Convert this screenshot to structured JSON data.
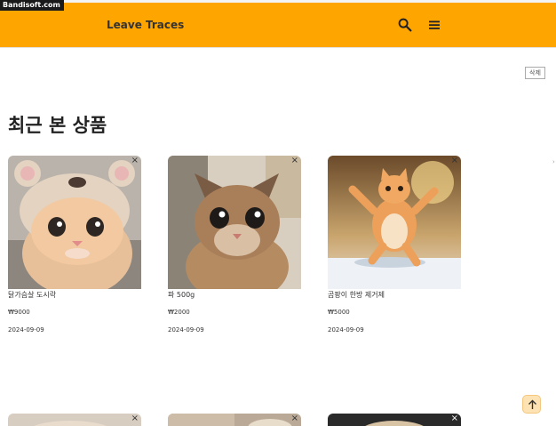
{
  "watermark": "Bandisoft.com",
  "header": {
    "brand": "Leave Traces",
    "search_icon": "search-icon",
    "menu_icon": "hamburger-menu-icon",
    "background": "#ffa500"
  },
  "toolbar": {
    "delete_label": "삭제"
  },
  "page": {
    "title": "최근 본 상품"
  },
  "products": [
    {
      "name": "닭가슴살 도시락",
      "price": "₩9000",
      "date": "2024-09-09",
      "close": "×"
    },
    {
      "name": "파 500g",
      "price": "₩2000",
      "date": "2024-09-09",
      "close": "×"
    },
    {
      "name": "곰팡이 한방 제거제",
      "price": "₩5000",
      "date": "2024-09-09",
      "close": "×"
    }
  ],
  "products_row2": [
    {
      "close": "×"
    },
    {
      "close": "×"
    },
    {
      "close": "×"
    }
  ],
  "scroll_top_icon": "arrow-up-icon"
}
